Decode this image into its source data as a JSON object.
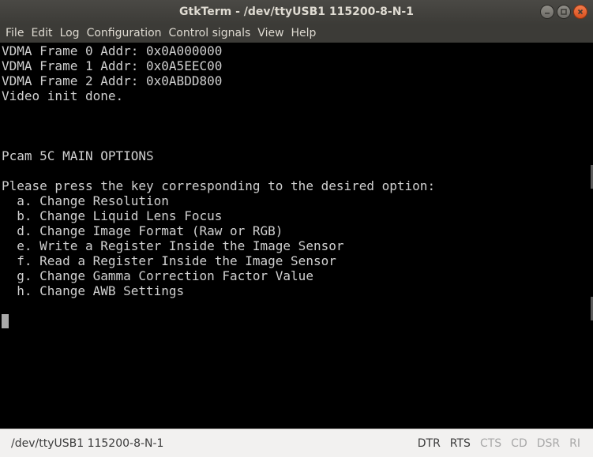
{
  "window": {
    "title": "GtkTerm - /dev/ttyUSB1  115200-8-N-1"
  },
  "menu": {
    "items": [
      {
        "label": "File"
      },
      {
        "label": "Edit"
      },
      {
        "label": "Log"
      },
      {
        "label": "Configuration"
      },
      {
        "label": "Control signals"
      },
      {
        "label": "View"
      },
      {
        "label": "Help"
      }
    ]
  },
  "terminal": {
    "lines": [
      "VDMA Frame 0 Addr: 0x0A000000",
      "VDMA Frame 1 Addr: 0x0A5EEC00",
      "VDMA Frame 2 Addr: 0x0ABDD800",
      "Video init done.",
      "",
      "",
      "",
      "Pcam 5C MAIN OPTIONS",
      "",
      "Please press the key corresponding to the desired option:",
      "  a. Change Resolution",
      "  b. Change Liquid Lens Focus",
      "  d. Change Image Format (Raw or RGB)",
      "  e. Write a Register Inside the Image Sensor",
      "  f. Read a Register Inside the Image Sensor",
      "  g. Change Gamma Correction Factor Value",
      "  h. Change AWB Settings",
      ""
    ]
  },
  "statusbar": {
    "port": "/dev/ttyUSB1  115200-8-N-1",
    "signals": [
      {
        "label": "DTR",
        "active": true
      },
      {
        "label": "RTS",
        "active": true
      },
      {
        "label": "CTS",
        "active": false
      },
      {
        "label": "CD",
        "active": false
      },
      {
        "label": "DSR",
        "active": false
      },
      {
        "label": "RI",
        "active": false
      }
    ]
  },
  "colors": {
    "terminal_bg": "#000000",
    "terminal_fg": "#d0d0d0",
    "titlebar_bg": "#3c3b37",
    "close_button": "#e0561f"
  }
}
